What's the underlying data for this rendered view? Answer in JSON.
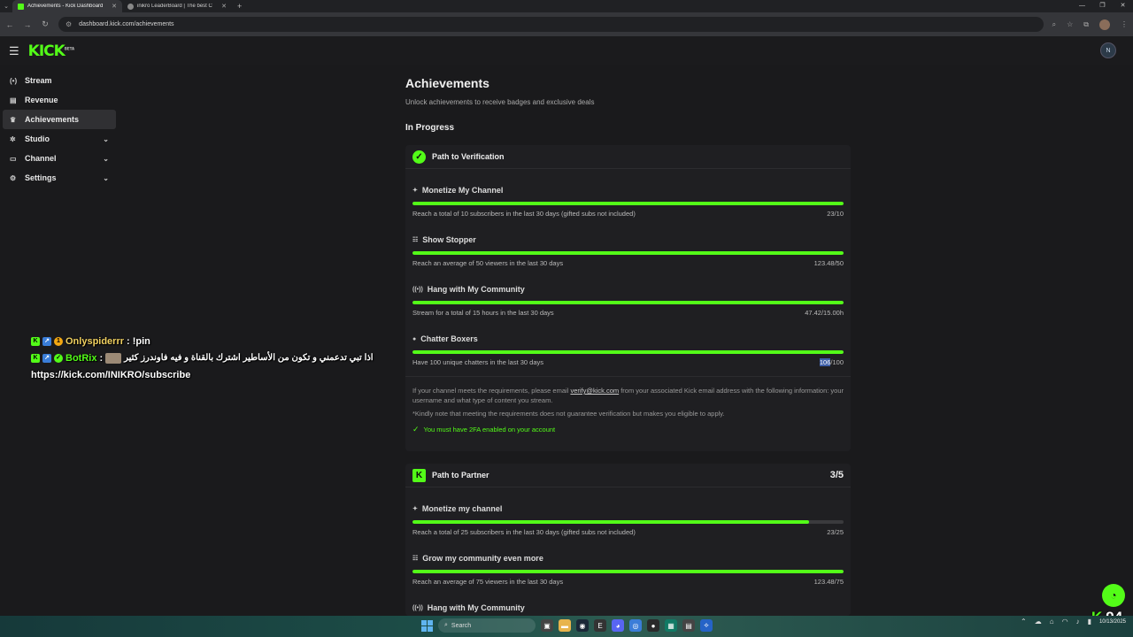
{
  "browser": {
    "tabs": [
      {
        "title": "Achievements - Kick Dashboard",
        "active": true
      },
      {
        "title": "inikro LeaderBoard | The best C",
        "active": false
      }
    ],
    "url": "dashboard.kick.com/achievements"
  },
  "app": {
    "logo": "KICK",
    "logo_tag": "BETA",
    "user_initial": "N"
  },
  "sidebar": {
    "items": [
      {
        "label": "Stream",
        "icon": "broadcast-icon"
      },
      {
        "label": "Revenue",
        "icon": "revenue-icon"
      },
      {
        "label": "Achievements",
        "icon": "trophy-icon",
        "active": true
      },
      {
        "label": "Studio",
        "icon": "studio-icon"
      },
      {
        "label": "Channel",
        "icon": "channel-icon"
      },
      {
        "label": "Settings",
        "icon": "gear-icon"
      }
    ]
  },
  "chat": [
    {
      "user": "Onlyspiderrr",
      "sep": ":",
      "message": "!pin"
    },
    {
      "user": "BotRix",
      "sep": ":",
      "message": "اذا تبي تدعمني و تكون من الأساطير اشترك بالقناة و فيه فاوندرز كثير",
      "link": "https://kick.com/INIKRO/subscribe"
    }
  ],
  "page": {
    "title": "Achievements",
    "subtitle": "Unlock achievements to receive badges and exclusive deals",
    "section": "In Progress"
  },
  "verification": {
    "name": "Path to Verification",
    "items": [
      {
        "title": "Monetize My Channel",
        "desc": "Reach a total of 10 subscribers in the last 30 days (gifted subs not included)",
        "value": "23/10",
        "progress": 1.0
      },
      {
        "title": "Show Stopper",
        "desc": "Reach an average of 50 viewers in the last 30 days",
        "value": "123.48/50",
        "progress": 1.0
      },
      {
        "title": "Hang with My Community",
        "desc": "Stream for a total of 15 hours in the last 30 days",
        "value": "47.42/15.00h",
        "progress": 1.0
      },
      {
        "title": "Chatter Boxers",
        "desc": "Have 100 unique chatters in the last 30 days",
        "value_sel": "106",
        "value_rest": "/100",
        "progress": 1.0
      }
    ],
    "note_before_link": "If your channel meets the requirements, please email ",
    "note_link": "verify@kick.com",
    "note_after_link": " from your associated Kick email address with the following information: your username and what type of content you stream.",
    "note2": "*Kindly note that meeting the requirements does not guarantee verification but makes you eligible to apply.",
    "twofa": "You must have 2FA enabled on your account"
  },
  "partner": {
    "name": "Path to Partner",
    "count": "3/5",
    "items": [
      {
        "title": "Monetize my channel",
        "desc": "Reach a total of 25 subscribers in the last 30 days (gifted subs not included)",
        "value": "23/25",
        "progress": 0.92
      },
      {
        "title": "Grow my community even more",
        "desc": "Reach an average of 75 viewers in the last 30 days",
        "value": "123.48/75",
        "progress": 1.0
      },
      {
        "title": "Hang with My Community"
      }
    ]
  },
  "overlay": {
    "viewer_count": "94"
  },
  "taskbar": {
    "search_placeholder": "Search",
    "date": "10/13/2025"
  },
  "colors": {
    "accent": "#53fc18",
    "bg": "#1a1a1c",
    "card": "#1f1f22"
  }
}
